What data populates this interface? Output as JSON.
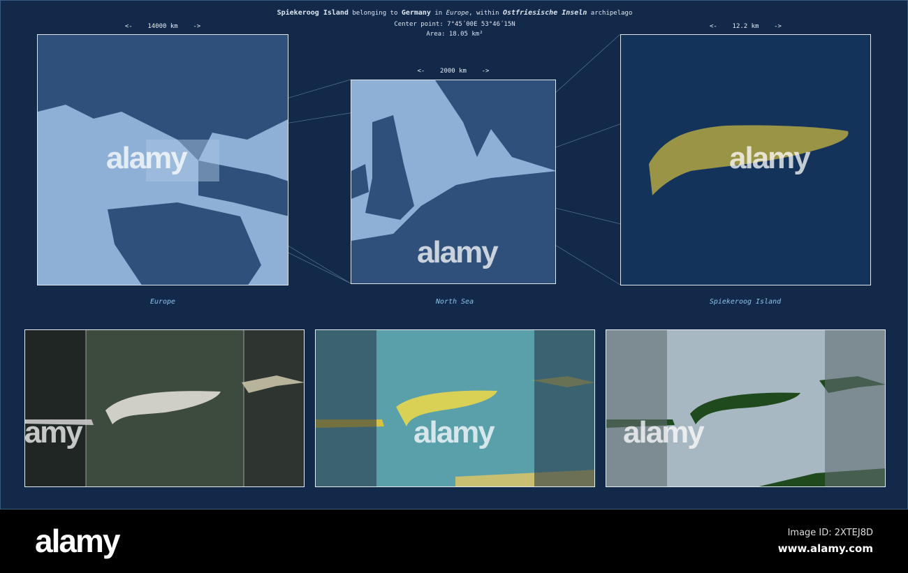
{
  "header": {
    "island": "Spiekeroog Island",
    "t1": " belonging to ",
    "country": "Germany",
    "t2": " in ",
    "continent": "Europe",
    "t3": ", within ",
    "archipelago": "Ostfriesische Inseln",
    "t4": " archipelago",
    "center_point": "Center point: 7°45´00E  53°46´15N",
    "area": "Area: 18.05 km²"
  },
  "maps": [
    {
      "scale": "<-    14000 km    ->",
      "label": "Europe"
    },
    {
      "scale": "<-    2000 km    ->",
      "label": "North Sea"
    },
    {
      "scale": "<-    12.2 km    ->",
      "label": "Spiekeroog Island"
    }
  ],
  "footer": {
    "logo": "alamy",
    "image_id": "Image ID: 2XTEJ8D",
    "website": "www.alamy.com"
  },
  "watermark": "alamy",
  "colors": {
    "background": "#12294a",
    "island": "#9a9446",
    "label": "#8fc3ea"
  }
}
